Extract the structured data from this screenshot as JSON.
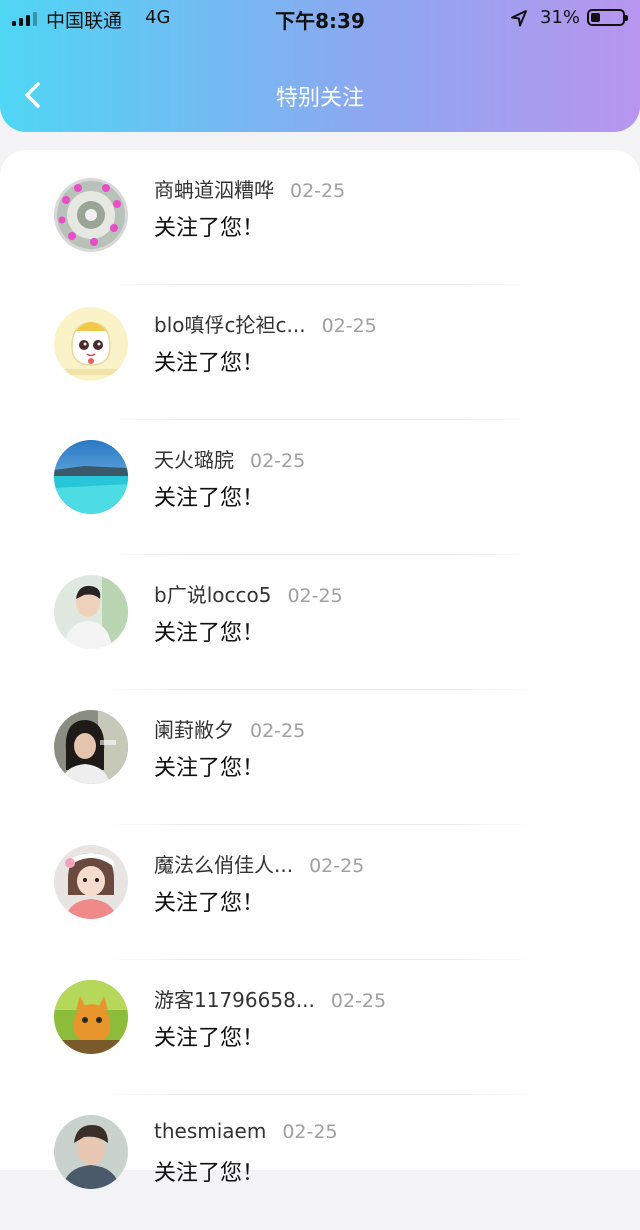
{
  "status_bar": {
    "carrier": "中国联通",
    "network": "4G",
    "time": "下午8:39",
    "battery_percent": "31%",
    "battery_level": 0.31
  },
  "nav": {
    "title": "特别关注",
    "back_icon": "chevron-left-icon"
  },
  "colors": {
    "header_gradient_start": "#4fd6f5",
    "header_gradient_end": "#b895ee",
    "name_color": "#333333",
    "date_color": "#a0a0a0"
  },
  "items": [
    {
      "name": "商蚺道泅糟哗",
      "date": "02-25",
      "message": "关注了您！"
    },
    {
      "name": "blo嗔俘c抡袒c...",
      "date": "02-25",
      "message": "关注了您！"
    },
    {
      "name": "天火璐脘",
      "date": "02-25",
      "message": "关注了您！"
    },
    {
      "name": "b广说locco5",
      "date": "02-25",
      "message": "关注了您！"
    },
    {
      "name": "阑葑敝夕",
      "date": "02-25",
      "message": "关注了您！"
    },
    {
      "name": "魔法么俏佳人...",
      "date": "02-25",
      "message": "关注了您！"
    },
    {
      "name": "游客11796658...",
      "date": "02-25",
      "message": "关注了您！"
    },
    {
      "name": "thesmiaem",
      "date": "02-25",
      "message": "关注了您！"
    }
  ]
}
